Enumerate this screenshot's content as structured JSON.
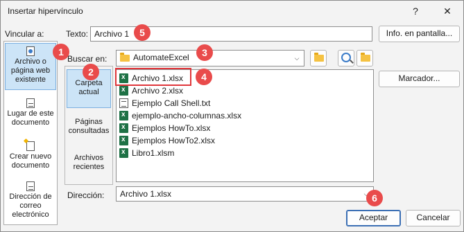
{
  "window": {
    "title": "Insertar hipervínculo",
    "help_glyph": "?",
    "close_glyph": "✕"
  },
  "link_to": {
    "label": "Vincular a:",
    "items": [
      {
        "line1": "Archivo o",
        "line2": "página web",
        "line3": "existente",
        "icon": "web-page-icon"
      },
      {
        "line1": "Lugar de este",
        "line2": "documento",
        "icon": "document-place-icon"
      },
      {
        "line1": "Crear nuevo",
        "line2": "documento",
        "icon": "new-document-icon"
      },
      {
        "line1": "Dirección de",
        "line2": "correo",
        "line3": "electrónico",
        "icon": "email-icon"
      }
    ]
  },
  "text_field": {
    "label": "Texto:",
    "value": "Archivo 1",
    "screentip_button": "Info. en pantalla..."
  },
  "look_in": {
    "label": "Buscar en:",
    "value": "AutomateExcel",
    "icon": "folder-icon"
  },
  "folders": {
    "items": [
      {
        "line1": "Carpeta",
        "line2": "actual"
      },
      {
        "line1": "Páginas",
        "line2": "consultadas"
      },
      {
        "line1": "Archivos",
        "line2": "recientes"
      }
    ]
  },
  "files": [
    {
      "name": "Archivo 1.xlsx",
      "type": "excel"
    },
    {
      "name": "Archivo 2.xlsx",
      "type": "excel"
    },
    {
      "name": "Ejemplo Call Shell.txt",
      "type": "text"
    },
    {
      "name": "ejemplo-ancho-columnas.xlsx",
      "type": "excel"
    },
    {
      "name": "Ejemplos HowTo.xlsx",
      "type": "excel"
    },
    {
      "name": "Ejemplos HowTo2.xlsx",
      "type": "excel"
    },
    {
      "name": "Libro1.xlsm",
      "type": "excel"
    }
  ],
  "bookmark_button": "Marcador...",
  "address": {
    "label": "Dirección:",
    "value": "Archivo 1.xlsx"
  },
  "buttons": {
    "accept": "Aceptar",
    "cancel": "Cancelar"
  },
  "badges": [
    "1",
    "2",
    "3",
    "4",
    "5",
    "6"
  ],
  "colors": {
    "badge": "#e94b4b",
    "highlight_border": "#e0353a",
    "selection": "#cce4f7",
    "excel_green": "#1e7145"
  }
}
